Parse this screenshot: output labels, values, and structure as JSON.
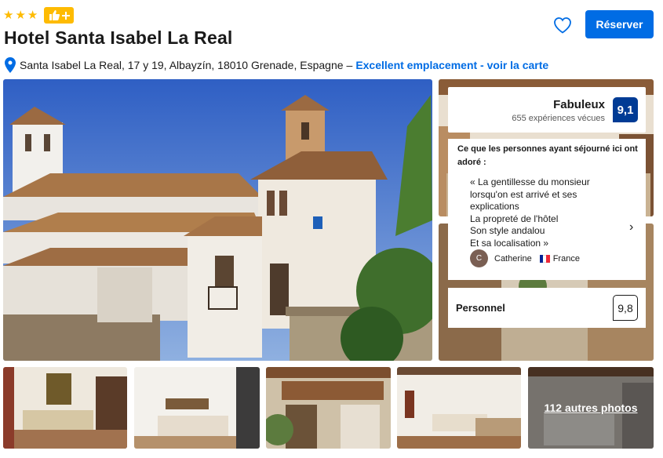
{
  "header": {
    "stars": 3,
    "genius_badge_icon": "thumbs-up-plus-icon",
    "title": "Hotel Santa Isabel La Real",
    "address": "Santa Isabel La Real, 17 y 19, Albayzín, 18010 Grenade, Espagne",
    "separator": "–",
    "map_link": "Excellent emplacement - voir la carte",
    "reserve_label": "Réserver",
    "favorite_icon": "heart-icon"
  },
  "rating": {
    "word": "Fabuleux",
    "count": "655 expériences vécues",
    "score": "9,1"
  },
  "review": {
    "heading": "Ce que les personnes ayant séjourné ici ont adoré :",
    "quote_lines": [
      "« La gentillesse du monsieur",
      "lorsqu'on est arrivé et ses",
      "explications",
      "La propreté de l'hôtel",
      "Son style andalou",
      "Et sa localisation »"
    ],
    "avatar_initial": "C",
    "reviewer_name": "Catherine",
    "reviewer_country": "France"
  },
  "staff": {
    "label": "Personnel",
    "score": "9,8"
  },
  "gallery": {
    "more_photos": "112 autres photos"
  },
  "colors": {
    "primary_blue": "#006ce4",
    "score_blue": "#003b95",
    "star_yellow": "#febb02"
  }
}
